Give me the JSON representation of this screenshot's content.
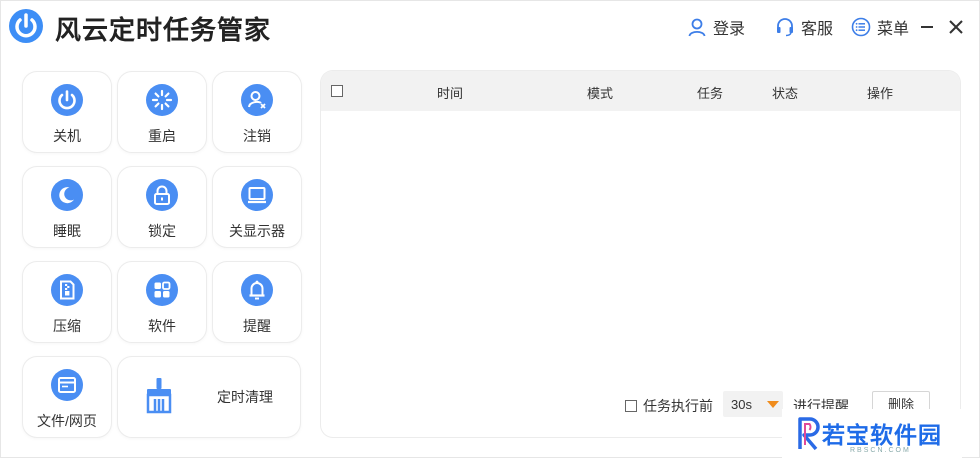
{
  "header": {
    "title": "风云定时任务管家",
    "login": "登录",
    "service": "客服",
    "menu": "菜单"
  },
  "tiles": [
    {
      "label": "关机",
      "icon": "power-icon"
    },
    {
      "label": "重启",
      "icon": "restart-icon"
    },
    {
      "label": "注销",
      "icon": "logout-user-icon"
    },
    {
      "label": "睡眠",
      "icon": "moon-icon"
    },
    {
      "label": "锁定",
      "icon": "lock-icon"
    },
    {
      "label": "关显示器",
      "icon": "monitor-icon"
    },
    {
      "label": "压缩",
      "icon": "archive-icon"
    },
    {
      "label": "软件",
      "icon": "apps-icon"
    },
    {
      "label": "提醒",
      "icon": "bell-icon"
    },
    {
      "label": "文件/网页",
      "icon": "browser-window-icon"
    },
    {
      "label": "定时清理",
      "icon": "broom-icon"
    }
  ],
  "table": {
    "columns": [
      "时间",
      "模式",
      "任务",
      "状态",
      "操作"
    ]
  },
  "footer": {
    "before_label": "任务执行前",
    "delay_value": "30s",
    "remind_label": "进行提醒",
    "delete_label": "删除"
  },
  "watermark": {
    "text": "若宝软件园",
    "sub": "RBSCN.COM"
  },
  "colors": {
    "accent": "#4a8ef3",
    "logo": "#3d8ef6",
    "dropdown_arrow": "#f08c1c"
  }
}
